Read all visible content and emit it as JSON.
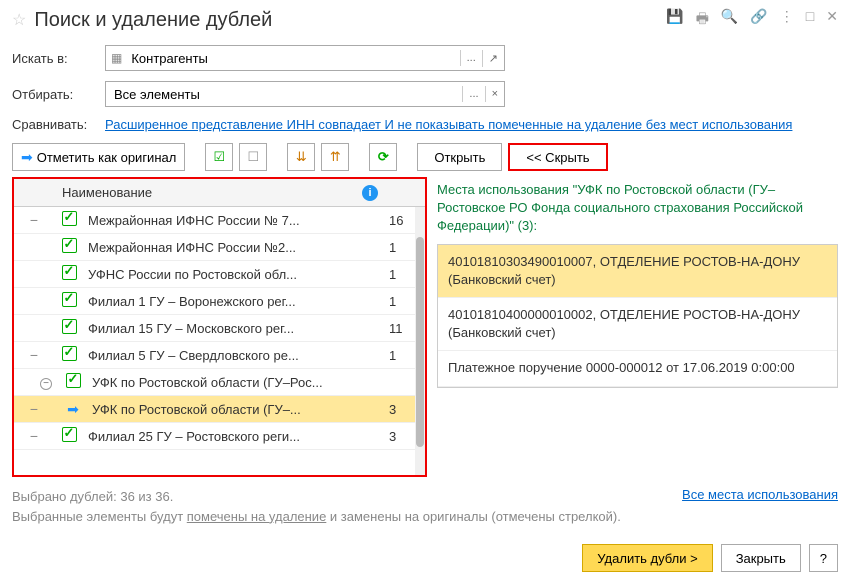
{
  "header": {
    "title": "Поиск и удаление дублей"
  },
  "form": {
    "search_in_label": "Искать в:",
    "search_in_value": "Контрагенты",
    "filter_label": "Отбирать:",
    "filter_value": "Все элементы",
    "compare_label": "Сравнивать:",
    "compare_link": "Расширенное представление ИНН совпадает И не показывать помеченные на удаление без мест использования"
  },
  "toolbar": {
    "mark_original": "Отметить как оригинал",
    "open": "Открыть",
    "hide": "<<  Скрыть"
  },
  "grid": {
    "header_name": "Наименование",
    "rows": [
      {
        "expand": "−",
        "checked": true,
        "name": "Межрайонная ИФНС России № 7...",
        "count": "16"
      },
      {
        "expand": "",
        "checked": true,
        "name": "Межрайонная ИФНС России №2...",
        "count": "1"
      },
      {
        "expand": "",
        "checked": true,
        "name": "УФНС России по Ростовской обл...",
        "count": "1"
      },
      {
        "expand": "",
        "checked": true,
        "name": "Филиал 1 ГУ – Воронежского рег...",
        "count": "1"
      },
      {
        "expand": "",
        "checked": true,
        "name": "Филиал 15 ГУ – Московского рег...",
        "count": "11"
      },
      {
        "expand": "−",
        "checked": true,
        "name": "Филиал 5 ГУ – Свердловского ре...",
        "count": "1"
      },
      {
        "expand": "⊖",
        "checked": true,
        "name": "УФК по Ростовской области (ГУ–Рос...",
        "count": "",
        "indent": true
      },
      {
        "expand": "−",
        "checked": false,
        "arrow": true,
        "name": "УФК по Ростовской области (ГУ–...",
        "count": "3",
        "selected": true,
        "indent": true
      },
      {
        "expand": "−",
        "checked": true,
        "name": "Филиал 25 ГУ – Ростовского реги...",
        "count": "3"
      }
    ]
  },
  "usage": {
    "title": "Места использования \"УФК по Ростовской области (ГУ–Ростовское РО Фонда социального страхования  Российской Федерации)\" (3):",
    "items": [
      {
        "text": "40101810303490010007, ОТДЕЛЕНИЕ РОСТОВ-НА-ДОНУ (Банковский счет)",
        "highlighted": true
      },
      {
        "text": "40101810400000010002, ОТДЕЛЕНИЕ РОСТОВ-НА-ДОНУ (Банковский счет)"
      },
      {
        "text": "Платежное поручение 0000-000012 от 17.06.2019 0:00:00"
      }
    ]
  },
  "footer": {
    "selected": "Выбрано дублей: 36 из 36.",
    "note_pre": "Выбранные элементы будут ",
    "note_link": "помечены на удаление",
    "note_post": " и заменены на оригиналы (отмечены стрелкой).",
    "all_usage": "Все места использования"
  },
  "actions": {
    "delete": "Удалить дубли >",
    "close": "Закрыть",
    "help": "?"
  }
}
